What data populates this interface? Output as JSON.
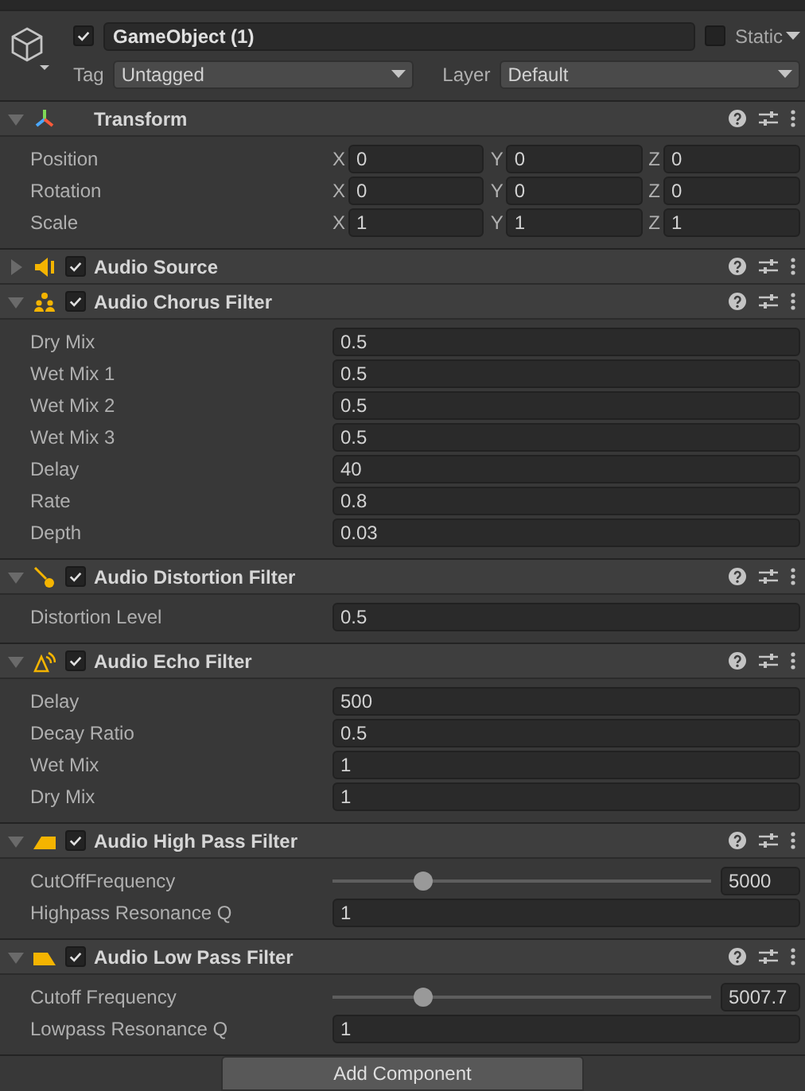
{
  "object": {
    "active": true,
    "name": "GameObject (1)",
    "static": {
      "label": "Static",
      "checked": false
    },
    "tag": {
      "label": "Tag",
      "value": "Untagged"
    },
    "layer": {
      "label": "Layer",
      "value": "Default"
    }
  },
  "components": [
    {
      "kind": "transform",
      "title": "Transform",
      "expanded": true,
      "fields": [
        {
          "kind": "vector3",
          "label": "Position",
          "axes": [
            {
              "axis": "X",
              "value": "0"
            },
            {
              "axis": "Y",
              "value": "0"
            },
            {
              "axis": "Z",
              "value": "0"
            }
          ]
        },
        {
          "kind": "vector3",
          "label": "Rotation",
          "axes": [
            {
              "axis": "X",
              "value": "0"
            },
            {
              "axis": "Y",
              "value": "0"
            },
            {
              "axis": "Z",
              "value": "0"
            }
          ]
        },
        {
          "kind": "vector3",
          "label": "Scale",
          "axes": [
            {
              "axis": "X",
              "value": "1"
            },
            {
              "axis": "Y",
              "value": "1"
            },
            {
              "axis": "Z",
              "value": "1"
            }
          ]
        }
      ]
    },
    {
      "kind": "source",
      "title": "Audio Source",
      "expanded": false,
      "enabled": true
    },
    {
      "kind": "chorus",
      "title": "Audio Chorus Filter",
      "expanded": true,
      "enabled": true,
      "fields": [
        {
          "kind": "float",
          "label": "Dry Mix",
          "value": "0.5"
        },
        {
          "kind": "float",
          "label": "Wet Mix 1",
          "value": "0.5"
        },
        {
          "kind": "float",
          "label": "Wet Mix 2",
          "value": "0.5"
        },
        {
          "kind": "float",
          "label": "Wet Mix 3",
          "value": "0.5"
        },
        {
          "kind": "float",
          "label": "Delay",
          "value": "40"
        },
        {
          "kind": "float",
          "label": "Rate",
          "value": "0.8"
        },
        {
          "kind": "float",
          "label": "Depth",
          "value": "0.03"
        }
      ]
    },
    {
      "kind": "distortion",
      "title": "Audio Distortion Filter",
      "expanded": true,
      "enabled": true,
      "fields": [
        {
          "kind": "float",
          "label": "Distortion Level",
          "value": "0.5"
        }
      ]
    },
    {
      "kind": "echo",
      "title": "Audio Echo Filter",
      "expanded": true,
      "enabled": true,
      "fields": [
        {
          "kind": "float",
          "label": "Delay",
          "value": "500"
        },
        {
          "kind": "float",
          "label": "Decay Ratio",
          "value": "0.5"
        },
        {
          "kind": "float",
          "label": "Wet Mix",
          "value": "1"
        },
        {
          "kind": "float",
          "label": "Dry Mix",
          "value": "1"
        }
      ]
    },
    {
      "kind": "highpass",
      "title": "Audio High Pass Filter",
      "expanded": true,
      "enabled": true,
      "fields": [
        {
          "kind": "slider",
          "label": "CutOffFrequency",
          "level": 0.24,
          "value": "5000"
        },
        {
          "kind": "float",
          "label": "Highpass Resonance Q",
          "value": "1"
        }
      ]
    },
    {
      "kind": "lowpass",
      "title": "Audio Low Pass Filter",
      "expanded": true,
      "enabled": true,
      "fields": [
        {
          "kind": "slider",
          "label": "Cutoff Frequency",
          "level": 0.24,
          "value": "5007.7"
        },
        {
          "kind": "float",
          "label": "Lowpass Resonance Q",
          "value": "1"
        }
      ]
    }
  ],
  "add_button": "Add Component"
}
